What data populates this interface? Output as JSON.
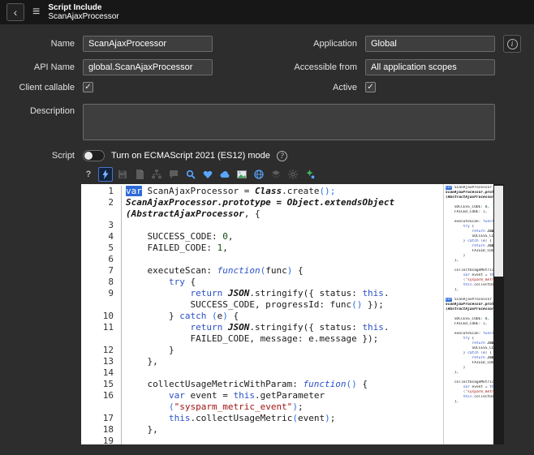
{
  "header": {
    "back": "‹",
    "menu": "≡",
    "title": "Script Include",
    "subtitle": "ScanAjaxProcessor"
  },
  "form": {
    "name_label": "Name",
    "name_value": "ScanAjaxProcessor",
    "application_label": "Application",
    "application_value": "Global",
    "api_name_label": "API Name",
    "api_name_value": "global.ScanAjaxProcessor",
    "accessible_label": "Accessible from",
    "accessible_value": "All application scopes",
    "client_callable_label": "Client callable",
    "client_callable_checked": true,
    "active_label": "Active",
    "active_checked": true,
    "description_label": "Description",
    "description_value": "",
    "script_label": "Script",
    "es_toggle_label": "Turn on ECMAScript 2021 (ES12) mode",
    "es_toggle_on": false,
    "help_glyph": "?",
    "info_glyph": "i",
    "check_glyph": "✓"
  },
  "editor": {
    "toolbar": [
      {
        "name": "help",
        "active": false,
        "disabled": false
      },
      {
        "name": "format-code",
        "active": true,
        "disabled": false
      },
      {
        "name": "save",
        "active": false,
        "disabled": true
      },
      {
        "name": "document",
        "active": false,
        "disabled": true
      },
      {
        "name": "tree",
        "active": false,
        "disabled": true
      },
      {
        "name": "comment",
        "active": false,
        "disabled": true
      },
      {
        "name": "search",
        "active": false,
        "disabled": false
      },
      {
        "name": "bookmark",
        "active": false,
        "disabled": false
      },
      {
        "name": "cloud",
        "active": false,
        "disabled": false
      },
      {
        "name": "image",
        "active": false,
        "disabled": false
      },
      {
        "name": "globe-help",
        "active": false,
        "disabled": false
      },
      {
        "name": "layers",
        "active": false,
        "disabled": true
      },
      {
        "name": "gear",
        "active": false,
        "disabled": true
      },
      {
        "name": "ai-assist",
        "active": false,
        "disabled": false
      }
    ],
    "rows": [
      {
        "n": "1",
        "s": [
          [
            "var",
            "k hl"
          ],
          [
            " ScanAjaxProcessor = ",
            "p"
          ],
          [
            "Class",
            "t"
          ],
          [
            ".create",
            "p"
          ],
          [
            "()",
            "b"
          ],
          [
            ";",
            "b"
          ]
        ]
      },
      {
        "n": "2",
        "s": [
          [
            "ScanAjaxProcessor.prototype = Object.extendsObject",
            "t"
          ]
        ]
      },
      {
        "n": "",
        "s": [
          [
            "(AbstractAjaxProcessor",
            "t"
          ],
          [
            ", {",
            "p"
          ]
        ]
      },
      {
        "n": "3",
        "s": []
      },
      {
        "n": "4",
        "s": [
          [
            "    SUCCESS_CODE: ",
            "p"
          ],
          [
            "0",
            "n"
          ],
          [
            ",",
            "p"
          ]
        ]
      },
      {
        "n": "5",
        "s": [
          [
            "    FAILED_CODE: ",
            "p"
          ],
          [
            "1",
            "n"
          ],
          [
            ",",
            "p"
          ]
        ]
      },
      {
        "n": "6",
        "s": []
      },
      {
        "n": "7",
        "s": [
          [
            "    executeScan: ",
            "p"
          ],
          [
            "function",
            "k i"
          ],
          [
            "(",
            "b"
          ],
          [
            "func",
            "p"
          ],
          [
            ")",
            "b"
          ],
          [
            " {",
            "p"
          ]
        ]
      },
      {
        "n": "8",
        "s": [
          [
            "        ",
            "p"
          ],
          [
            "try",
            "k"
          ],
          [
            " {",
            "p"
          ]
        ]
      },
      {
        "n": "9",
        "s": [
          [
            "            ",
            "p"
          ],
          [
            "return",
            "k"
          ],
          [
            " ",
            "p"
          ],
          [
            "JSON",
            "t"
          ],
          [
            ".stringify({ status: ",
            "p"
          ],
          [
            "this",
            "k"
          ],
          [
            ".",
            "p"
          ]
        ]
      },
      {
        "n": "",
        "s": [
          [
            "            SUCCESS_CODE, progressId: func",
            "p"
          ],
          [
            "()",
            "b"
          ],
          [
            " });",
            "p"
          ]
        ]
      },
      {
        "n": "10",
        "s": [
          [
            "        } ",
            "p"
          ],
          [
            "catch",
            "k"
          ],
          [
            " ",
            "p"
          ],
          [
            "(",
            "b"
          ],
          [
            "e",
            "p"
          ],
          [
            ")",
            "b"
          ],
          [
            " {",
            "p"
          ]
        ]
      },
      {
        "n": "11",
        "s": [
          [
            "            ",
            "p"
          ],
          [
            "return",
            "k"
          ],
          [
            " ",
            "p"
          ],
          [
            "JSON",
            "t"
          ],
          [
            ".stringify({ status: ",
            "p"
          ],
          [
            "this",
            "k"
          ],
          [
            ".",
            "p"
          ]
        ]
      },
      {
        "n": "",
        "s": [
          [
            "            FAILED_CODE, message: e.message });",
            "p"
          ]
        ]
      },
      {
        "n": "12",
        "s": [
          [
            "        }",
            "p"
          ]
        ]
      },
      {
        "n": "13",
        "s": [
          [
            "    },",
            "p"
          ]
        ]
      },
      {
        "n": "14",
        "s": []
      },
      {
        "n": "15",
        "s": [
          [
            "    collectUsageMetricWithParam: ",
            "p"
          ],
          [
            "function",
            "k i"
          ],
          [
            "()",
            "b"
          ],
          [
            " {",
            "p"
          ]
        ]
      },
      {
        "n": "16",
        "s": [
          [
            "        ",
            "p"
          ],
          [
            "var",
            "k"
          ],
          [
            " event = ",
            "p"
          ],
          [
            "this",
            "k"
          ],
          [
            ".getParameter",
            "p"
          ]
        ]
      },
      {
        "n": "",
        "s": [
          [
            "        ",
            "p"
          ],
          [
            "(",
            "b"
          ],
          [
            "\"sysparm_metric_event\"",
            "s"
          ],
          [
            ")",
            "b"
          ],
          [
            ";",
            "p"
          ]
        ]
      },
      {
        "n": "17",
        "s": [
          [
            "        ",
            "p"
          ],
          [
            "this",
            "k"
          ],
          [
            ".collectUsageMetric",
            "p"
          ],
          [
            "(",
            "b"
          ],
          [
            "event",
            "p"
          ],
          [
            ")",
            "b"
          ],
          [
            ";",
            "p"
          ]
        ]
      },
      {
        "n": "18",
        "s": [
          [
            "    },",
            "p"
          ]
        ]
      },
      {
        "n": "19",
        "s": []
      }
    ]
  }
}
